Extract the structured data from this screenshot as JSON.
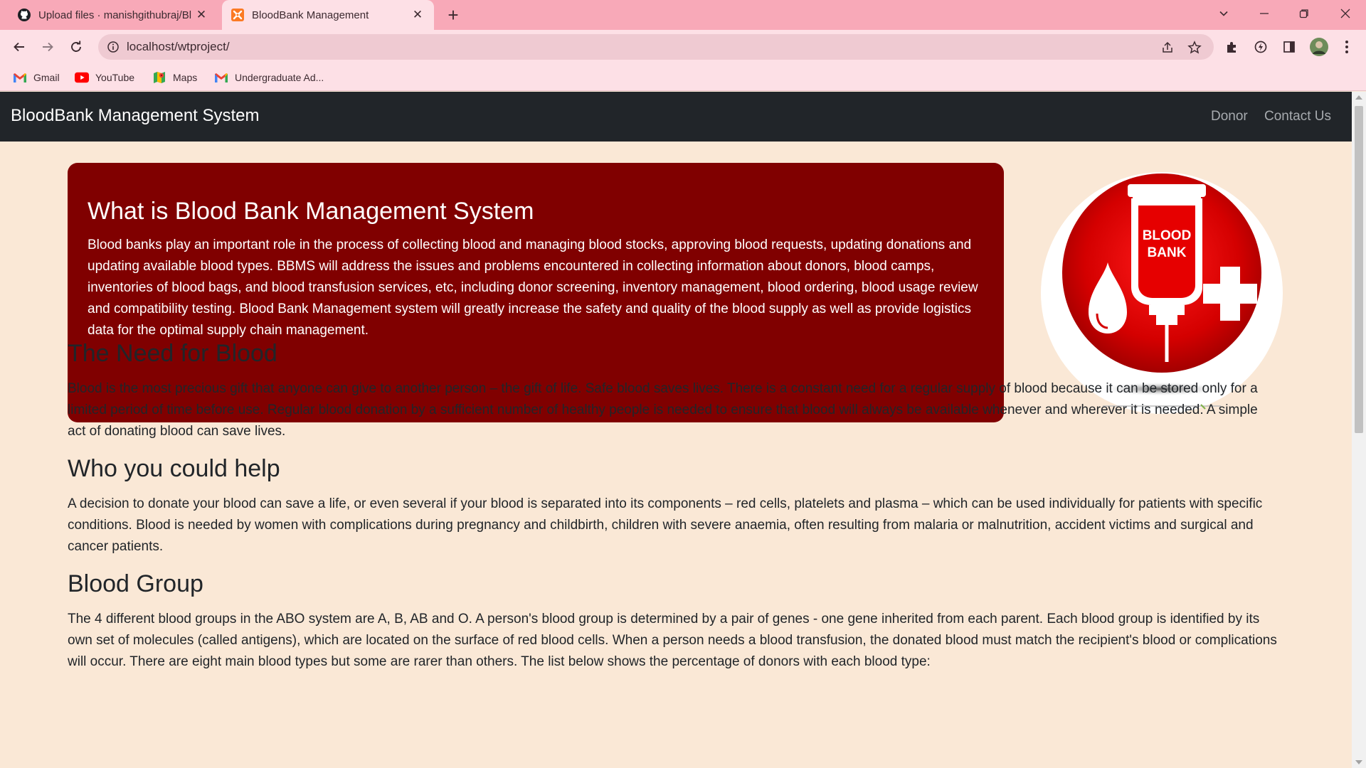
{
  "browser": {
    "tabs": [
      {
        "title": "Upload files · manishgithubraj/Bl",
        "icon": "github-icon",
        "active": false
      },
      {
        "title": "BloodBank Management",
        "icon": "xampp-icon",
        "active": true
      }
    ],
    "url": "localhost/wtproject/",
    "bookmarks": [
      {
        "label": "Gmail",
        "icon": "gmail-icon"
      },
      {
        "label": "YouTube",
        "icon": "youtube-icon"
      },
      {
        "label": "Maps",
        "icon": "maps-icon"
      },
      {
        "label": "Undergraduate Ad...",
        "icon": "gmail-icon"
      }
    ]
  },
  "site": {
    "brand": "BloodBank Management System",
    "nav": [
      "Donor",
      "Contact Us"
    ],
    "hero": {
      "title": "What is Blood Bank Management System",
      "body": "Blood banks play an important role in the process of collecting blood and managing blood stocks, approving blood requests, updating donations and updating available blood types. BBMS will address the issues and problems encountered in collecting information about donors, blood camps, inventories of blood bags, and blood transfusion services, etc, including donor screening, inventory management, blood ordering, blood usage review and compatibility testing. Blood Bank Management system will greatly increase the safety and quality of the blood supply as well as provide logistics data for the optimal supply chain management."
    },
    "logo_text": [
      "BLOOD",
      "BANK"
    ],
    "sections": [
      {
        "heading": "The Need for Blood",
        "body": "Blood is the most precious gift that anyone can give to another person – the gift of life. Safe blood saves lives. There is a constant need for a regular supply of blood because it can be stored only for a limited period of time before use. Regular blood donation by a sufficient number of healthy people is needed to ensure that blood will always be available whenever and wherever it is needed. A simple act of donating blood can save lives."
      },
      {
        "heading": "Who you could help",
        "body": "A decision to donate your blood can save a life, or even several if your blood is separated into its components – red cells, platelets and plasma – which can be used individually for patients with specific conditions. Blood is needed by women with complications during pregnancy and childbirth, children with severe anaemia, often resulting from malaria or malnutrition, accident victims and surgical and cancer patients."
      },
      {
        "heading": "Blood Group",
        "body": "The 4 different blood groups in the ABO system are A, B, AB and O. A person's blood group is determined by a pair of genes - one gene inherited from each parent. Each blood group is identified by its own set of molecules (called antigens), which are located on the surface of red blood cells. When a person needs a blood transfusion, the donated blood must match the recipient's blood or complications will occur. There are eight main blood types but some are rarer than others. The list below shows the percentage of donors with each blood type:"
      }
    ]
  },
  "colors": {
    "tabbar": "#f8a9b8",
    "toolbar": "#fde0e6",
    "navbar": "#212529",
    "hero": "#800000",
    "page_bg": "#fae8d6"
  }
}
